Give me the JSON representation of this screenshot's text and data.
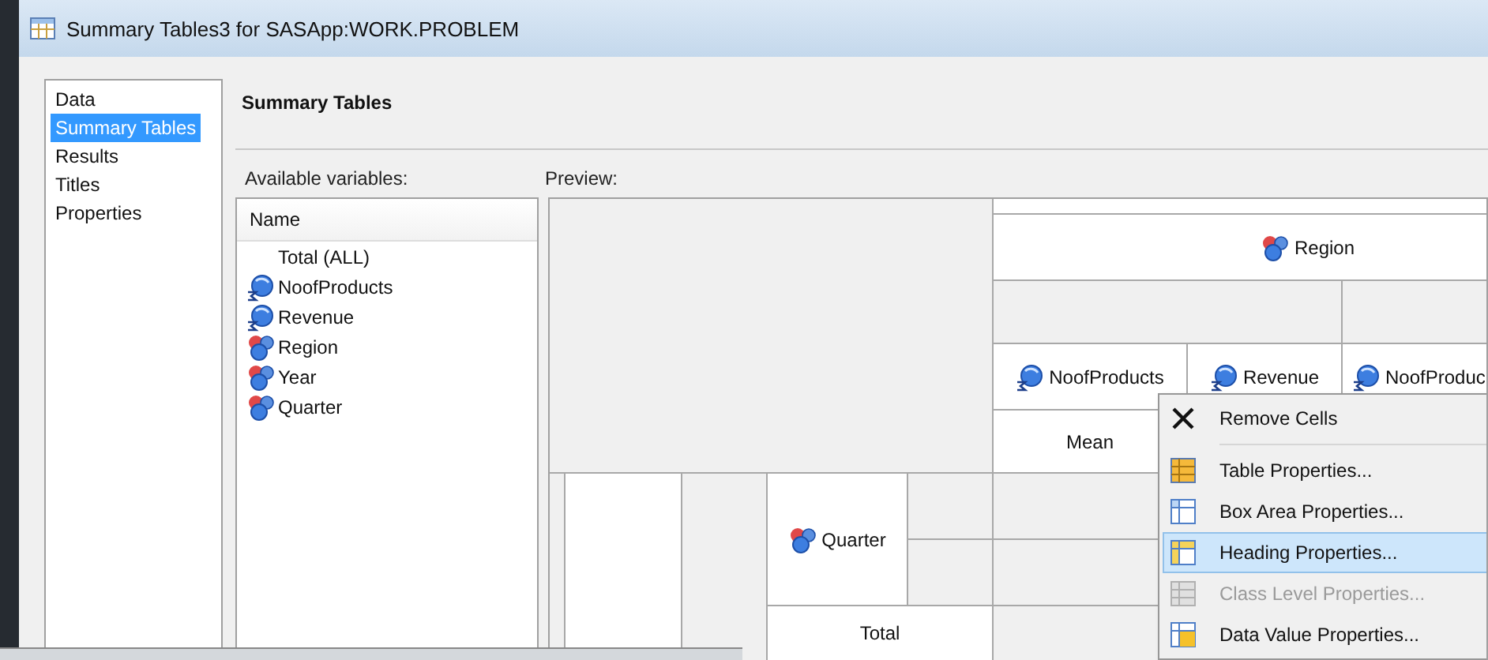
{
  "window": {
    "title": "Summary Tables3 for SASApp:WORK.PROBLEM"
  },
  "nav": {
    "items": [
      {
        "label": "Data",
        "selected": false
      },
      {
        "label": "Summary Tables",
        "selected": true
      },
      {
        "label": "Results",
        "selected": false
      },
      {
        "label": "Titles",
        "selected": false
      },
      {
        "label": "Properties",
        "selected": false
      }
    ]
  },
  "page_heading": "Summary Tables",
  "variables": {
    "label": "Available variables:",
    "column": "Name",
    "items": [
      {
        "label": "Total (ALL)",
        "kind": "total"
      },
      {
        "label": "NoofProducts",
        "kind": "analysis"
      },
      {
        "label": "Revenue",
        "kind": "analysis"
      },
      {
        "label": "Region",
        "kind": "class"
      },
      {
        "label": "Year",
        "kind": "class"
      },
      {
        "label": "Quarter",
        "kind": "class"
      }
    ]
  },
  "preview": {
    "label": "Preview:",
    "column_class": {
      "label": "Region",
      "kind": "class"
    },
    "analysis_headings": [
      {
        "label": "NoofProducts",
        "kind": "analysis"
      },
      {
        "label": "Revenue",
        "kind": "analysis"
      },
      {
        "label": "NoofProduc",
        "kind": "analysis"
      }
    ],
    "statistic": "Mean",
    "row_class": {
      "label": "Quarter",
      "kind": "class"
    },
    "row_total": "Total"
  },
  "context_menu": {
    "items": [
      {
        "kind": "item",
        "label": "Remove Cells",
        "selected": false,
        "disabled": false
      },
      {
        "kind": "separator"
      },
      {
        "kind": "item",
        "label": "Table Properties...",
        "selected": false,
        "disabled": false
      },
      {
        "kind": "item",
        "label": "Box Area Properties...",
        "selected": false,
        "disabled": false
      },
      {
        "kind": "item",
        "label": "Heading Properties...",
        "selected": true,
        "disabled": false
      },
      {
        "kind": "item",
        "label": "Class Level Properties...",
        "selected": false,
        "disabled": true
      },
      {
        "kind": "item",
        "label": "Data Value Properties...",
        "selected": false,
        "disabled": false
      }
    ]
  }
}
